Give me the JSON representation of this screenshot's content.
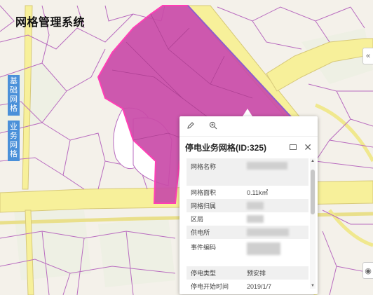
{
  "app": {
    "title": "网格管理系统"
  },
  "side_tabs": [
    {
      "label": [
        "基",
        "础",
        "网",
        "格"
      ]
    },
    {
      "label": [
        "业",
        "务",
        "网",
        "格"
      ]
    }
  ],
  "colors": {
    "map_bg": "#f4f1ea",
    "road_fill": "#f7f09a",
    "road_edge": "#d7c97a",
    "boundary": "#b86bbf",
    "grid_fill": "#c94ba8",
    "grid_edge": "#ff3fb5",
    "tab_blue": "#4a90d9"
  },
  "popup": {
    "tools": {
      "edit_icon": "pencil-icon",
      "zoom_icon": "zoom-in-icon"
    },
    "title": "停电业务网格(ID:325)",
    "rows": [
      {
        "key": "网格名称",
        "value": ""
      },
      {
        "key": "网格面积",
        "value": "0.11k㎡"
      },
      {
        "key": "网格归属",
        "value": ""
      },
      {
        "key": "区局",
        "value": ""
      },
      {
        "key": "供电所",
        "value": ""
      },
      {
        "key": "事件编码",
        "value": ""
      },
      {
        "key": "停电类型",
        "value": "预安排"
      },
      {
        "key": "停电开始时间",
        "value": "2019/1/7"
      }
    ]
  }
}
